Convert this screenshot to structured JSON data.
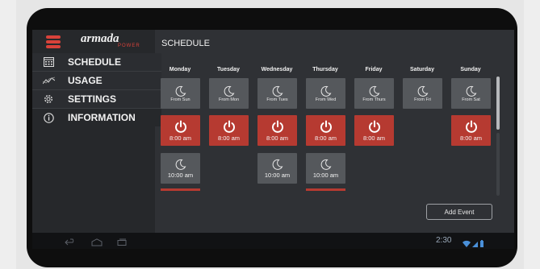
{
  "app": {
    "logo": "armada",
    "logo_sub": "POWER",
    "title": "SCHEDULE"
  },
  "sidebar": {
    "items": [
      {
        "label": "SCHEDULE",
        "icon": "calendar-icon"
      },
      {
        "label": "USAGE",
        "icon": "chart-line-icon"
      },
      {
        "label": "SETTINGS",
        "icon": "gear-icon"
      },
      {
        "label": "INFORMATION",
        "icon": "info-icon"
      }
    ]
  },
  "schedule": {
    "days": [
      "Monday",
      "Tuesday",
      "Wednesday",
      "Thursday",
      "Friday",
      "Saturday",
      "Sunday"
    ],
    "sleep_tiles": [
      "From Sun",
      "From Mon",
      "From Tues",
      "From Wed",
      "From Thurs",
      "From Fri",
      "From Sat"
    ],
    "power_time": "8:00 am",
    "sleep_time": "10:00 am"
  },
  "actions": {
    "add_event": "Add Event"
  },
  "status": {
    "clock": "2:30"
  },
  "colors": {
    "accent": "#b63a31",
    "tile": "#55585c",
    "background": "#2f3135"
  }
}
